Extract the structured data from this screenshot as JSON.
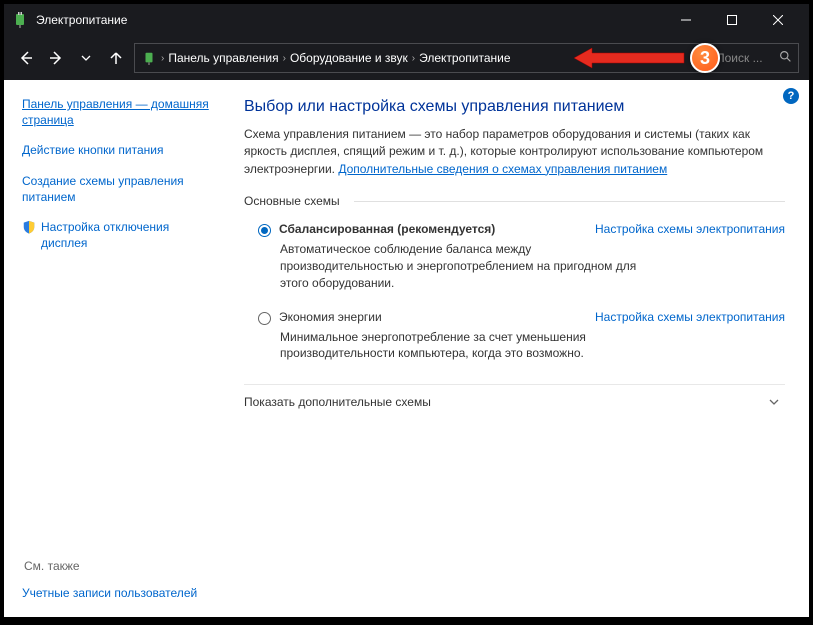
{
  "titlebar": {
    "title": "Электропитание"
  },
  "breadcrumb": {
    "items": [
      "Панель управления",
      "Оборудование и звук",
      "Электропитание"
    ]
  },
  "search": {
    "placeholder": "Поиск ..."
  },
  "annotation": {
    "badge": "3"
  },
  "sidebar": {
    "home": "Панель управления — домашняя страница",
    "links": [
      "Действие кнопки питания",
      "Создание схемы управления питанием",
      "Настройка отключения дисплея"
    ],
    "footer_label": "См. также",
    "footer_link": "Учетные записи пользователей"
  },
  "main": {
    "heading": "Выбор или настройка схемы управления питанием",
    "desc_part1": "Схема управления питанием — это набор параметров оборудования и системы (таких как яркость дисплея, спящий режим и т. д.), которые контролируют использование компьютером электроэнергии. ",
    "desc_link": "Дополнительные сведения о схемах управления питанием",
    "group_label": "Основные схемы",
    "plans": [
      {
        "name": "Сбалансированная (рекомендуется)",
        "checked": true,
        "settings_link": "Настройка схемы электропитания",
        "desc": "Автоматическое соблюдение баланса между производительностью и энергопотреблением на пригодном для этого оборудовании."
      },
      {
        "name": "Экономия энергии",
        "checked": false,
        "settings_link": "Настройка схемы электропитания",
        "desc": "Минимальное энергопотребление за счет уменьшения производительности компьютера, когда это возможно."
      }
    ],
    "expander": "Показать дополнительные схемы"
  }
}
